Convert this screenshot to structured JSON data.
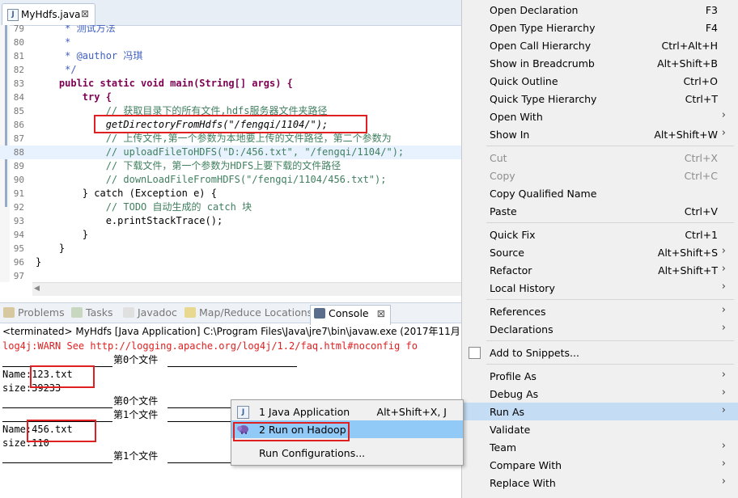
{
  "editor": {
    "tab_label": "MyHdfs.java",
    "tab_close": "⊠",
    "code_lines": [
      {
        "num": "79",
        "text": "     * 测试方法"
      },
      {
        "num": "80",
        "text": "     *"
      },
      {
        "num": "81",
        "text": "     * @author 冯琪"
      },
      {
        "num": "82",
        "text": "     */"
      },
      {
        "num": "83",
        "text": "    public static void main(String[] args) {"
      },
      {
        "num": "84",
        "text": "        try {"
      },
      {
        "num": "85",
        "text": "            // 获取目录下的所有文件,hdfs服务器文件夹路径"
      },
      {
        "num": "86",
        "text": "            getDirectoryFromHdfs(\"/fengqi/1104/\");"
      },
      {
        "num": "87",
        "text": "            // 上传文件,第一个参数为本地要上传的文件路径，第二个参数为"
      },
      {
        "num": "88",
        "text": "            // uploadFileToHDFS(\"D:/456.txt\", \"/fengqi/1104/\");"
      },
      {
        "num": "89",
        "text": "            // 下载文件，第一个参数为HDFS上要下载的文件路径"
      },
      {
        "num": "90",
        "text": "            // downLoadFileFromHDFS(\"/fengqi/1104/456.txt\");"
      },
      {
        "num": "91",
        "text": "        } catch (Exception e) {"
      },
      {
        "num": "92",
        "text": "            // TODO 自动生成的 catch 块"
      },
      {
        "num": "93",
        "text": "            e.printStackTrace();"
      },
      {
        "num": "94",
        "text": "        }"
      },
      {
        "num": "95",
        "text": "    }"
      },
      {
        "num": "96",
        "text": "}"
      },
      {
        "num": "97",
        "text": ""
      }
    ]
  },
  "views": {
    "tabs": [
      {
        "label": "Problems"
      },
      {
        "label": "Tasks"
      },
      {
        "label": "Javadoc"
      },
      {
        "label": "Map/Reduce Locations"
      },
      {
        "label": "Console"
      }
    ],
    "console_close": "⊠"
  },
  "console": {
    "status": "<terminated> MyHdfs [Java Application] C:\\Program Files\\Java\\jre7\\bin\\javaw.exe (2017年11月11日",
    "warn_line": "log4j:WARN See http://logging.apache.org/log4j/1.2/faq.html#noconfig fo",
    "lines": [
      "第0个文件",
      "Name:123.txt",
      "size:39233",
      "第0个文件",
      "第1个文件",
      "Name:456.txt",
      "size:110",
      "第1个文件"
    ]
  },
  "context_menu": {
    "items": [
      {
        "label": "Open Declaration",
        "shortcut": "F3"
      },
      {
        "label": "Open Type Hierarchy",
        "shortcut": "F4"
      },
      {
        "label": "Open Call Hierarchy",
        "shortcut": "Ctrl+Alt+H"
      },
      {
        "label": "Show in Breadcrumb",
        "shortcut": "Alt+Shift+B"
      },
      {
        "label": "Quick Outline",
        "shortcut": "Ctrl+O"
      },
      {
        "label": "Quick Type Hierarchy",
        "shortcut": "Ctrl+T"
      },
      {
        "label": "Open With",
        "shortcut": ""
      },
      {
        "label": "Show In",
        "shortcut": "Alt+Shift+W"
      },
      {
        "label": "Cut",
        "shortcut": "Ctrl+X"
      },
      {
        "label": "Copy",
        "shortcut": "Ctrl+C"
      },
      {
        "label": "Copy Qualified Name",
        "shortcut": ""
      },
      {
        "label": "Paste",
        "shortcut": "Ctrl+V"
      },
      {
        "label": "Quick Fix",
        "shortcut": "Ctrl+1"
      },
      {
        "label": "Source",
        "shortcut": "Alt+Shift+S"
      },
      {
        "label": "Refactor",
        "shortcut": "Alt+Shift+T"
      },
      {
        "label": "Local History",
        "shortcut": ""
      },
      {
        "label": "References",
        "shortcut": ""
      },
      {
        "label": "Declarations",
        "shortcut": ""
      },
      {
        "label": "Add to Snippets...",
        "shortcut": ""
      },
      {
        "label": "Profile As",
        "shortcut": ""
      },
      {
        "label": "Debug As",
        "shortcut": ""
      },
      {
        "label": "Run As",
        "shortcut": ""
      },
      {
        "label": "Validate",
        "shortcut": ""
      },
      {
        "label": "Team",
        "shortcut": ""
      },
      {
        "label": "Compare With",
        "shortcut": ""
      },
      {
        "label": "Replace With",
        "shortcut": ""
      }
    ],
    "arrow": "›"
  },
  "run_as_submenu": {
    "items": [
      {
        "label": "1 Java Application",
        "shortcut": "Alt+Shift+X, J"
      },
      {
        "label": "2 Run on Hadoop",
        "shortcut": ""
      },
      {
        "label": "Run Configurations...",
        "shortcut": ""
      }
    ]
  },
  "colors": {
    "keyword": "#7f0055",
    "comment": "#3f7f5f",
    "string": "#2a00ff",
    "javadoc": "#3f5fbf",
    "warn": "#e02020",
    "highlight_box": "#e02020",
    "menu_selection": "#c4dcf4",
    "submenu_selection": "#91c9f7"
  },
  "icons": {
    "java_file": "java-file-icon",
    "hadoop": "hadoop-elephant-icon",
    "java_app": "java-app-icon",
    "snippets": "snippets-icon"
  }
}
